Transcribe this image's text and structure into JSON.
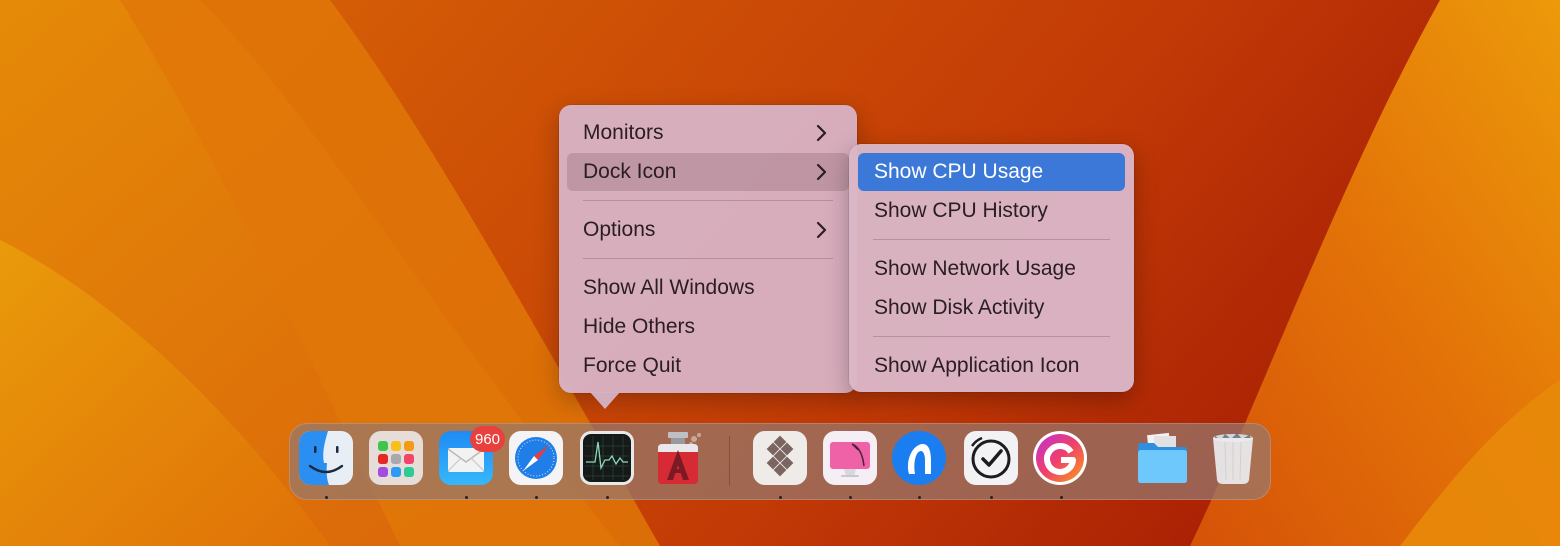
{
  "menu": {
    "items": [
      {
        "label": "Monitors",
        "has_submenu": true
      },
      {
        "label": "Dock Icon",
        "has_submenu": true,
        "highlighted": true
      },
      {
        "label": "Options",
        "has_submenu": true
      },
      {
        "label": "Show All Windows",
        "has_submenu": false
      },
      {
        "label": "Hide Others",
        "has_submenu": false
      },
      {
        "label": "Force Quit",
        "has_submenu": false
      }
    ]
  },
  "submenu": {
    "parent": "Dock Icon",
    "items": [
      {
        "label": "Show CPU Usage",
        "selected": true
      },
      {
        "label": "Show CPU History",
        "selected": false
      },
      {
        "label": "Show Network Usage",
        "selected": false
      },
      {
        "label": "Show Disk Activity",
        "selected": false
      },
      {
        "label": "Show Application Icon",
        "selected": false
      }
    ],
    "accent_color": "#3b78d8"
  },
  "dock": {
    "apps": [
      {
        "name": "Finder",
        "icon": "finder-icon",
        "running": true
      },
      {
        "name": "Launchpad",
        "icon": "launchpad-icon",
        "running": false
      },
      {
        "name": "Mail",
        "icon": "mail-icon",
        "running": true,
        "badge": "960"
      },
      {
        "name": "Safari",
        "icon": "safari-icon",
        "running": true
      },
      {
        "name": "Activity Monitor",
        "icon": "activity-monitor-icon",
        "running": true
      },
      {
        "name": "AppCleaner",
        "icon": "appcleaner-icon",
        "running": false
      },
      {
        "name": "Setapp",
        "icon": "setapp-icon",
        "running": true
      },
      {
        "name": "CleanMyMac",
        "icon": "cleanmymac-icon",
        "running": true
      },
      {
        "name": "AnyToDMG",
        "icon": "anytrans-icon",
        "running": true
      },
      {
        "name": "Timing",
        "icon": "clock-check-icon",
        "running": true
      },
      {
        "name": "Grammarly",
        "icon": "grammarly-icon",
        "running": true
      },
      {
        "name": "Downloads",
        "icon": "folder-icon",
        "running": false
      },
      {
        "name": "Trash",
        "icon": "trash-icon",
        "running": false
      }
    ],
    "badge_color": "#e8413d"
  }
}
